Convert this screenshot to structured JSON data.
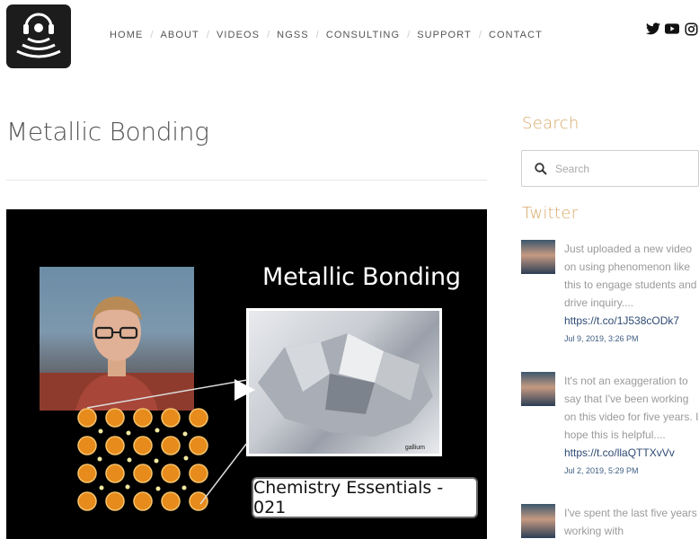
{
  "nav": {
    "items": [
      {
        "label": "HOME"
      },
      {
        "label": "ABOUT"
      },
      {
        "label": "VIDEOS"
      },
      {
        "label": "NGSS"
      },
      {
        "label": "CONSULTING"
      },
      {
        "label": "SUPPORT"
      },
      {
        "label": "CONTACT"
      }
    ]
  },
  "social": {
    "icons": [
      "twitter-icon",
      "youtube-icon",
      "instagram-icon"
    ]
  },
  "main": {
    "title": "Metallic Bonding",
    "video": {
      "title": "Metallic Bonding",
      "sample_caption": "gallium",
      "series_caption": "Chemistry Essentials - 021"
    }
  },
  "sidebar": {
    "search_heading": "Search",
    "search_placeholder": "Search",
    "twitter_heading": "Twitter",
    "tweets": [
      {
        "text": "Just uploaded a new video on using phenomenon like this to engage students and drive inquiry....",
        "link": "https://t.co/1J538cODk7",
        "date": "Jul 9, 2019, 3:26 PM"
      },
      {
        "text": "It's not an exaggeration to say that I've been working on this video for five years. I hope this is helpful....",
        "link": "https://t.co/llaQTTXvVv",
        "date": "Jul 2, 2019, 5:29 PM"
      },
      {
        "text": "I've spent the last five years working with",
        "link": "",
        "date": ""
      }
    ]
  },
  "colors": {
    "accent": "#d8a86a",
    "link": "#2d4a73",
    "nav_text": "#555555"
  }
}
